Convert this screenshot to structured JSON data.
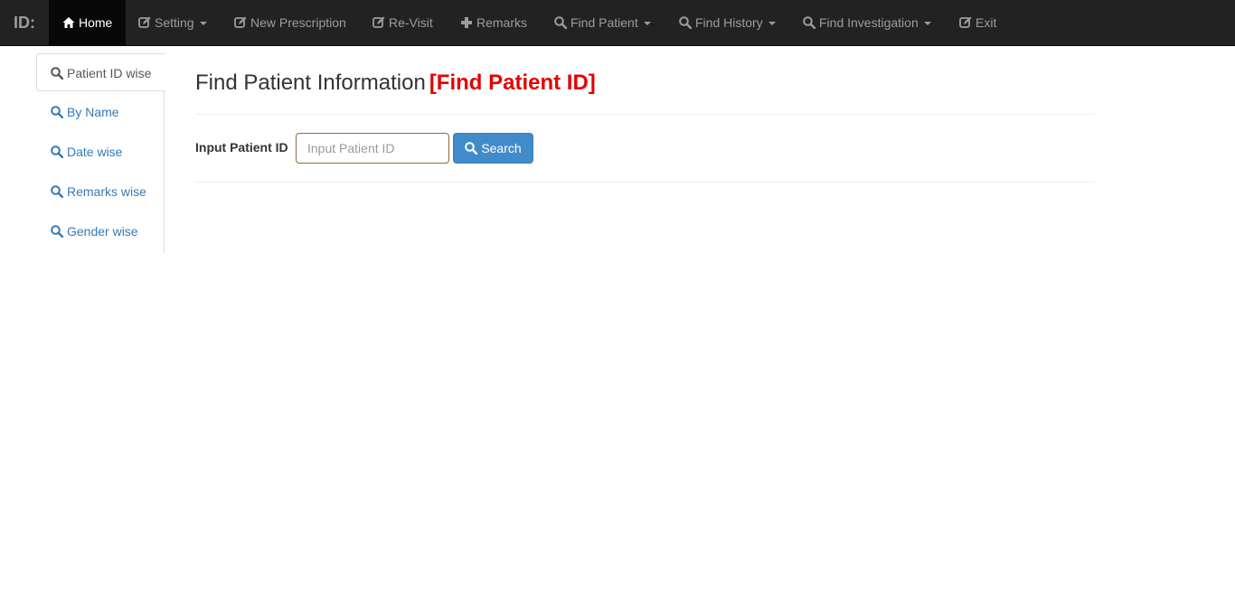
{
  "navbar": {
    "brand": "ID:",
    "items": [
      {
        "label": "Home",
        "icon": "home-icon",
        "active": true,
        "dropdown": false
      },
      {
        "label": "Setting",
        "icon": "edit-icon",
        "active": false,
        "dropdown": true
      },
      {
        "label": "New Prescription",
        "icon": "edit-icon",
        "active": false,
        "dropdown": false
      },
      {
        "label": "Re-Visit",
        "icon": "edit-icon",
        "active": false,
        "dropdown": false
      },
      {
        "label": "Remarks",
        "icon": "plus-icon",
        "active": false,
        "dropdown": false
      },
      {
        "label": "Find Patient",
        "icon": "search-icon",
        "active": false,
        "dropdown": true
      },
      {
        "label": "Find History",
        "icon": "search-icon",
        "active": false,
        "dropdown": true
      },
      {
        "label": "Find Investigation",
        "icon": "search-icon",
        "active": false,
        "dropdown": true
      },
      {
        "label": "Exit",
        "icon": "edit-icon",
        "active": false,
        "dropdown": false
      }
    ]
  },
  "sidebar": {
    "items": [
      {
        "label": "Patient ID wise",
        "icon": "search-icon",
        "active": true
      },
      {
        "label": "By Name",
        "icon": "search-icon",
        "active": false
      },
      {
        "label": "Date wise",
        "icon": "search-icon",
        "active": false
      },
      {
        "label": "Remarks wise",
        "icon": "search-icon",
        "active": false
      },
      {
        "label": "Gender wise",
        "icon": "search-icon",
        "active": false
      }
    ]
  },
  "main": {
    "title": "Find Patient Information",
    "title_tag": "[Find Patient ID]",
    "form": {
      "label": "Input Patient ID",
      "input_value": "",
      "input_placeholder": "Input Patient ID",
      "search_label": "Search"
    }
  },
  "colors": {
    "navbar_bg": "#222222",
    "accent": "#428bca",
    "link": "#337ab7",
    "title_tag": "#e60000"
  }
}
